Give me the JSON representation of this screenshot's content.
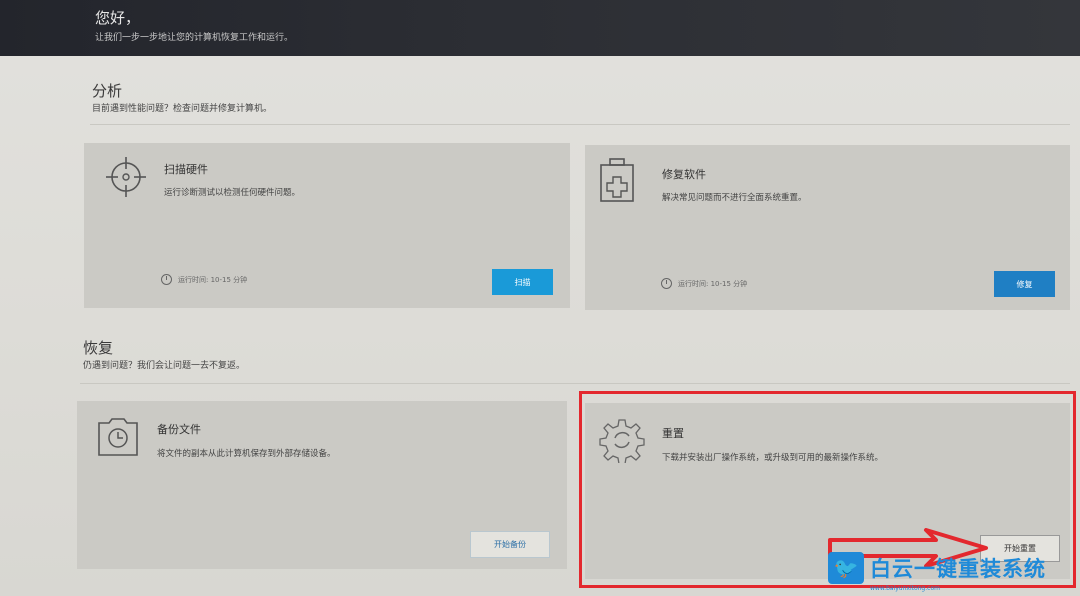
{
  "header": {
    "greeting": "您好，",
    "subtitle": "让我们一步一步地让您的计算机恢复工作和运行。"
  },
  "analysis": {
    "title": "分析",
    "subtitle": "目前遇到性能问题？检查问题并修复计算机。",
    "cards": [
      {
        "title": "扫描硬件",
        "desc": "运行诊断测试以检测任何硬件问题。",
        "meta": "运行时间: 10-15 分钟",
        "button": "扫描",
        "icon": "crosshair-icon"
      },
      {
        "title": "修复软件",
        "desc": "解决常见问题而不进行全面系统重置。",
        "meta": "运行时间: 10-15 分钟",
        "button": "修复",
        "icon": "first-aid-kit-icon"
      }
    ]
  },
  "recovery": {
    "title": "恢复",
    "subtitle": "仍遇到问题？我们会让问题一去不复返。",
    "cards": [
      {
        "title": "备份文件",
        "desc": "将文件的副本从此计算机保存到外部存储设备。",
        "button": "开始备份",
        "icon": "backup-clock-icon"
      },
      {
        "title": "重置",
        "desc": "下载并安装出厂操作系统，或升级到可用的最新操作系统。",
        "button": "开始重置",
        "icon": "gear-refresh-icon"
      }
    ]
  },
  "watermark": {
    "text": "白云一键重装系统",
    "url": "www.baiyunxitong.com"
  },
  "colors": {
    "accent_blue": "#1a9ad8",
    "highlight_red": "#e3282e"
  }
}
